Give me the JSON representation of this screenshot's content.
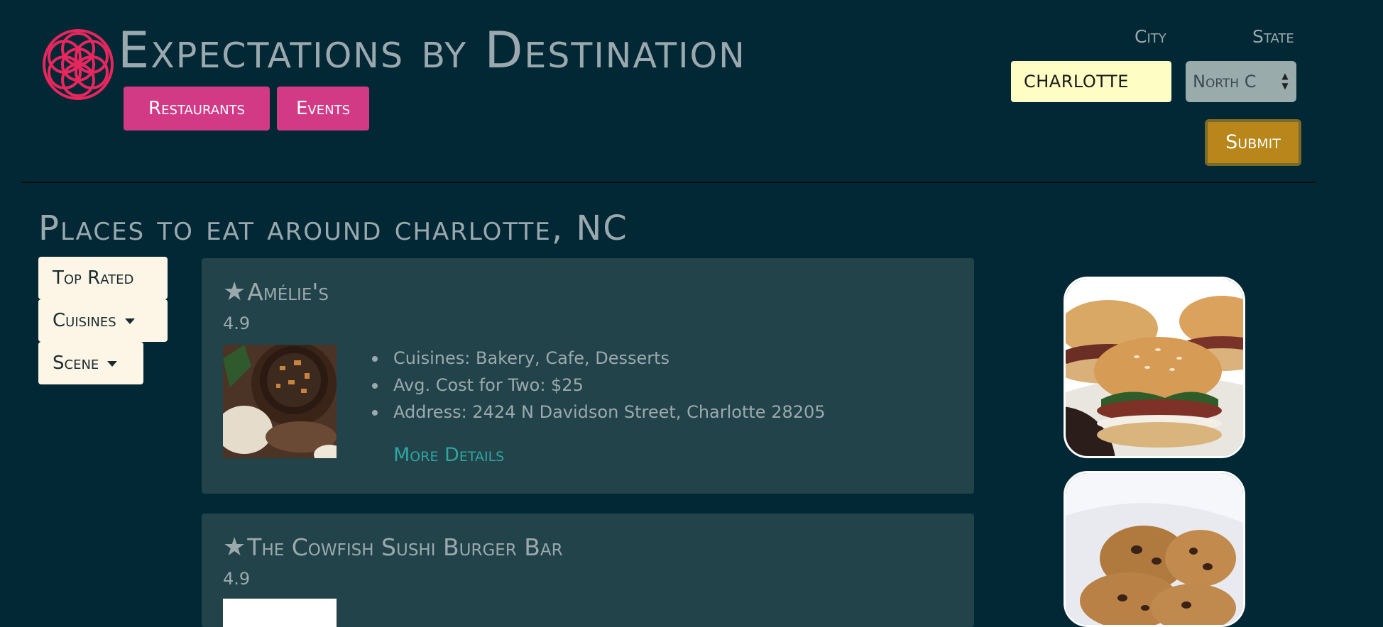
{
  "header": {
    "title": "Expectations by Destination",
    "nav": {
      "restaurants": "Restaurants",
      "events": "Events"
    }
  },
  "search": {
    "city_label": "City",
    "state_label": "State",
    "city_value": "CHARLOTTE",
    "state_value": "North Carolina",
    "state_visible": "North C",
    "submit_label": "Submit"
  },
  "main": {
    "heading": "Places to eat around charlotte, NC",
    "filters": {
      "top_rated": "Top Rated",
      "cuisines": "Cuisines",
      "scene": "Scene"
    },
    "restaurants": [
      {
        "name": "Amélie's",
        "rating": "4.9",
        "cuisines": "Cuisines: Bakery, Cafe, Desserts",
        "cost": "Avg. Cost for Two: $25",
        "address": "Address: 2424 N Davidson Street, Charlotte 28205",
        "more": "More Details"
      },
      {
        "name": "The Cowfish Sushi Burger Bar",
        "rating": "4.9"
      }
    ]
  },
  "colors": {
    "background": "#022836",
    "accent_pink": "#d33a86",
    "submit_gold": "#b8861b",
    "card": "#22434a",
    "link_teal": "#2fa5a0",
    "logo": "#e8265e"
  },
  "icons": {
    "logo": "flower-of-life-icon",
    "favorite": "star-icon",
    "dropdown": "caret-down-icon"
  }
}
